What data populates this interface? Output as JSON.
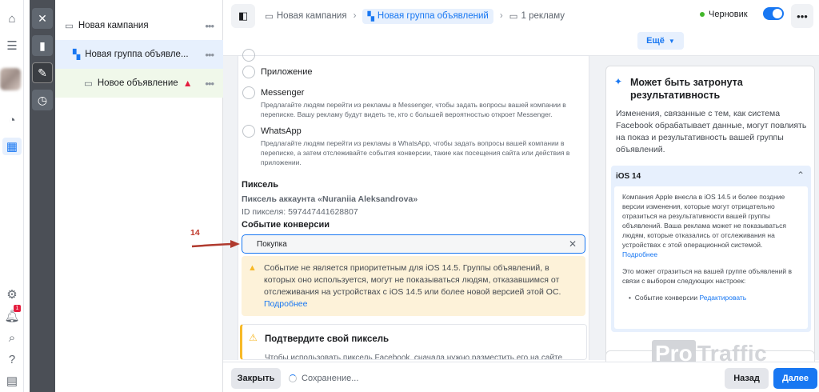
{
  "tree": {
    "campaign": "Новая кампания",
    "adset": "Новая группа объявле...",
    "ad": "Новое объявление"
  },
  "breadcrumbs": {
    "campaign": "Новая кампания",
    "adset": "Новая группа объявлений",
    "ad": "1 рекламу"
  },
  "status": {
    "label": "Черновик"
  },
  "more_label": "Ещё",
  "form": {
    "options": [
      {
        "title": "Приложение",
        "desc": ""
      },
      {
        "title": "Messenger",
        "desc": "Предлагайте людям перейти из рекламы в Messenger, чтобы задать вопросы вашей компании в переписке. Вашу рекламу будут видеть те, кто с большей вероятностью откроет Messenger."
      },
      {
        "title": "WhatsApp",
        "desc": "Предлагайте людям перейти из рекламы в WhatsApp, чтобы задать вопросы вашей компании в переписке, а затем отслеживайте события конверсии, такие как посещения сайта или действия в приложении."
      }
    ],
    "pixel_title": "Пиксель",
    "pixel_account": "Пиксель аккаунта «Nuraniia Aleksandrova»",
    "pixel_id": "ID пикселя: 597447441628807",
    "conversion_label": "Событие конверсии",
    "conversion_value": "Покупка",
    "warning_text": "Событие не является приоритетным для iOS 14.5. Группы объявлений, в которых оно используется, могут не показываться людям, отказавшимся от отслеживания на устройствах с iOS 14.5 или более новой версией этой ОС.",
    "warning_link": "Подробнее",
    "confirm_title": "Подтвердите свой пиксель",
    "confirm_desc": "Чтобы использовать пиксель Facebook, сначала нужно разместить его на сайте"
  },
  "annotation": {
    "number": "14"
  },
  "side": {
    "title": "Может быть затронута результативность",
    "text": "Изменения, связанные с тем, как система Facebook обрабатывает данные, могут повлиять на показ и результативность вашей группы объявлений.",
    "ios_heading": "iOS 14",
    "ios_p1": "Компания Apple внесла в iOS 14.5 и более поздние версии изменения, которые могут отрицательно отразиться на результативности вашей группы объявлений. Ваша реклама может не показываться людям, которые отказались от отслеживания на устройствах с этой операционной системой.",
    "ios_link": "Подробнее",
    "ios_p2": "Это может отразиться на вашей группе объявлений в связи с выбором следующих настроек:",
    "ios_item": "Событие конверсии",
    "ios_item_link": "Редактировать"
  },
  "bottom": {
    "close": "Закрыть",
    "saving": "Сохранение...",
    "back": "Назад",
    "next": "Далее"
  },
  "watermark": {
    "pro": "Pro",
    "traffic": "Traffic"
  },
  "colors": {
    "accent": "#1877f2",
    "warning_bg": "#fdf2d9",
    "warning_icon": "#f7b928",
    "error": "#e41e3f"
  }
}
